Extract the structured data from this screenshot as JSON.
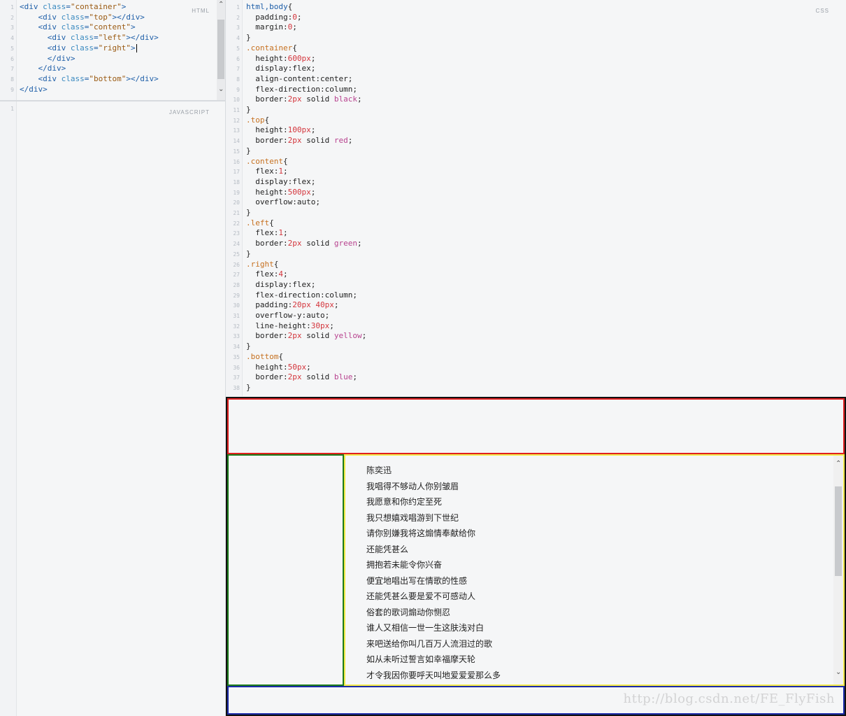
{
  "html_pane": {
    "label": "HTML",
    "lines": [
      {
        "n": "1",
        "parts": [
          [
            "tag",
            "<div "
          ],
          [
            "attr",
            "class"
          ],
          [
            "tag",
            "="
          ],
          [
            "str",
            "\"container\""
          ],
          [
            "tag",
            ">"
          ]
        ]
      },
      {
        "n": "2",
        "parts": [
          [
            "",
            "    "
          ],
          [
            "tag",
            "<div "
          ],
          [
            "attr",
            "class"
          ],
          [
            "tag",
            "="
          ],
          [
            "str",
            "\"top\""
          ],
          [
            "tag",
            "></div>"
          ]
        ]
      },
      {
        "n": "3",
        "parts": [
          [
            "",
            "    "
          ],
          [
            "tag",
            "<div "
          ],
          [
            "attr",
            "class"
          ],
          [
            "tag",
            "="
          ],
          [
            "str",
            "\"content\""
          ],
          [
            "tag",
            ">"
          ]
        ]
      },
      {
        "n": "4",
        "parts": [
          [
            "",
            "      "
          ],
          [
            "tag",
            "<div "
          ],
          [
            "attr",
            "class"
          ],
          [
            "tag",
            "="
          ],
          [
            "str",
            "\"left\""
          ],
          [
            "tag",
            "></div>"
          ]
        ]
      },
      {
        "n": "5",
        "parts": [
          [
            "",
            "      "
          ],
          [
            "tag",
            "<div "
          ],
          [
            "attr",
            "class"
          ],
          [
            "tag",
            "="
          ],
          [
            "str",
            "\"right\""
          ],
          [
            "tag",
            ">"
          ]
        ],
        "cursor": true
      },
      {
        "n": "6",
        "parts": [
          [
            "",
            "      "
          ],
          [
            "tag",
            "</div>"
          ]
        ]
      },
      {
        "n": "7",
        "parts": [
          [
            "",
            "    "
          ],
          [
            "tag",
            "</div>"
          ]
        ]
      },
      {
        "n": "8",
        "parts": [
          [
            "",
            "    "
          ],
          [
            "tag",
            "<div "
          ],
          [
            "attr",
            "class"
          ],
          [
            "tag",
            "="
          ],
          [
            "str",
            "\"bottom\""
          ],
          [
            "tag",
            "></div>"
          ]
        ]
      },
      {
        "n": "9",
        "parts": [
          [
            "tag",
            "</div>"
          ]
        ]
      }
    ]
  },
  "js_pane": {
    "label": "JAVASCRIPT",
    "lines": [
      {
        "n": "1",
        "parts": []
      }
    ]
  },
  "css_pane": {
    "label": "CSS",
    "lines": [
      {
        "n": "1",
        "parts": [
          [
            "kw",
            "html,body"
          ],
          [
            "",
            "{"
          ]
        ]
      },
      {
        "n": "2",
        "parts": [
          [
            "",
            "  padding:"
          ],
          [
            "num",
            "0"
          ],
          [
            "",
            ";"
          ]
        ]
      },
      {
        "n": "3",
        "parts": [
          [
            "",
            "  margin:"
          ],
          [
            "num",
            "0"
          ],
          [
            "",
            ";"
          ]
        ]
      },
      {
        "n": "4",
        "parts": [
          [
            "",
            "}"
          ]
        ]
      },
      {
        "n": "5",
        "parts": [
          [
            "sel",
            ".container"
          ],
          [
            "",
            "{"
          ]
        ]
      },
      {
        "n": "6",
        "parts": [
          [
            "",
            "  height:"
          ],
          [
            "num",
            "600px"
          ],
          [
            "",
            ";"
          ]
        ]
      },
      {
        "n": "7",
        "parts": [
          [
            "",
            "  display:flex;"
          ]
        ]
      },
      {
        "n": "8",
        "parts": [
          [
            "",
            "  align-content:center;"
          ]
        ]
      },
      {
        "n": "9",
        "parts": [
          [
            "",
            "  flex-direction:column;"
          ]
        ]
      },
      {
        "n": "10",
        "parts": [
          [
            "",
            "  border:"
          ],
          [
            "num",
            "2px"
          ],
          [
            "",
            " solid "
          ],
          [
            "val",
            "black"
          ],
          [
            "",
            ";"
          ]
        ]
      },
      {
        "n": "11",
        "parts": [
          [
            "",
            "}"
          ]
        ]
      },
      {
        "n": "12",
        "parts": [
          [
            "sel",
            ".top"
          ],
          [
            "",
            "{"
          ]
        ]
      },
      {
        "n": "13",
        "parts": [
          [
            "",
            "  height:"
          ],
          [
            "num",
            "100px"
          ],
          [
            "",
            ";"
          ]
        ]
      },
      {
        "n": "14",
        "parts": [
          [
            "",
            "  border:"
          ],
          [
            "num",
            "2px"
          ],
          [
            "",
            " solid "
          ],
          [
            "val",
            "red"
          ],
          [
            "",
            ";"
          ]
        ]
      },
      {
        "n": "15",
        "parts": [
          [
            "",
            "}"
          ]
        ]
      },
      {
        "n": "16",
        "parts": [
          [
            "sel",
            ".content"
          ],
          [
            "",
            "{"
          ]
        ]
      },
      {
        "n": "17",
        "parts": [
          [
            "",
            "  flex:"
          ],
          [
            "num",
            "1"
          ],
          [
            "",
            ";"
          ]
        ]
      },
      {
        "n": "18",
        "parts": [
          [
            "",
            "  display:flex;"
          ]
        ]
      },
      {
        "n": "19",
        "parts": [
          [
            "",
            "  height:"
          ],
          [
            "num",
            "500px"
          ],
          [
            "",
            ";"
          ]
        ]
      },
      {
        "n": "20",
        "parts": [
          [
            "",
            "  overflow:auto;"
          ]
        ]
      },
      {
        "n": "21",
        "parts": [
          [
            "",
            "}"
          ]
        ]
      },
      {
        "n": "22",
        "parts": [
          [
            "sel",
            ".left"
          ],
          [
            "",
            "{"
          ]
        ]
      },
      {
        "n": "23",
        "parts": [
          [
            "",
            "  flex:"
          ],
          [
            "num",
            "1"
          ],
          [
            "",
            ";"
          ]
        ]
      },
      {
        "n": "24",
        "parts": [
          [
            "",
            "  border:"
          ],
          [
            "num",
            "2px"
          ],
          [
            "",
            " solid "
          ],
          [
            "val",
            "green"
          ],
          [
            "",
            ";"
          ]
        ]
      },
      {
        "n": "25",
        "parts": [
          [
            "",
            "}"
          ]
        ]
      },
      {
        "n": "26",
        "parts": [
          [
            "sel",
            ".right"
          ],
          [
            "",
            "{"
          ]
        ]
      },
      {
        "n": "27",
        "parts": [
          [
            "",
            "  flex:"
          ],
          [
            "num",
            "4"
          ],
          [
            "",
            ";"
          ]
        ]
      },
      {
        "n": "28",
        "parts": [
          [
            "",
            "  display:flex;"
          ]
        ]
      },
      {
        "n": "29",
        "parts": [
          [
            "",
            "  flex-direction:column;"
          ]
        ]
      },
      {
        "n": "30",
        "parts": [
          [
            "",
            "  padding:"
          ],
          [
            "num",
            "20px 40px"
          ],
          [
            "",
            ";"
          ]
        ]
      },
      {
        "n": "31",
        "parts": [
          [
            "",
            "  overflow-y:auto;"
          ]
        ]
      },
      {
        "n": "32",
        "parts": [
          [
            "",
            "  line-height:"
          ],
          [
            "num",
            "30px"
          ],
          [
            "",
            ";"
          ]
        ]
      },
      {
        "n": "33",
        "parts": [
          [
            "",
            "  border:"
          ],
          [
            "num",
            "2px"
          ],
          [
            "",
            " solid "
          ],
          [
            "val",
            "yellow"
          ],
          [
            "",
            ";"
          ]
        ]
      },
      {
        "n": "34",
        "parts": [
          [
            "",
            "}"
          ]
        ]
      },
      {
        "n": "35",
        "parts": [
          [
            "sel",
            ".bottom"
          ],
          [
            "",
            "{"
          ]
        ]
      },
      {
        "n": "36",
        "parts": [
          [
            "",
            "  height:"
          ],
          [
            "num",
            "50px"
          ],
          [
            "",
            ";"
          ]
        ]
      },
      {
        "n": "37",
        "parts": [
          [
            "",
            "  border:"
          ],
          [
            "num",
            "2px"
          ],
          [
            "",
            " solid "
          ],
          [
            "val",
            "blue"
          ],
          [
            "",
            ";"
          ]
        ]
      },
      {
        "n": "38",
        "parts": [
          [
            "",
            "}"
          ]
        ]
      }
    ]
  },
  "preview": {
    "colors": {
      "container": "#111111",
      "top": "#e02020",
      "left": "#1a7a1a",
      "right": "#f2ea4a",
      "bottom": "#1a2aa8"
    },
    "lyrics": [
      "陈奕迅",
      "我唱得不够动人你别皱眉",
      "我愿意和你约定至死",
      "我只想嬉戏唱游到下世纪",
      "请你别嫌我将这煽情奉献给你",
      "还能凭甚么",
      "拥抱若未能令你兴奋",
      "便宜地唱出写在情歌的性感",
      "还能凭甚么要是爱不可感动人",
      "俗套的歌词煽动你恻忍",
      "谁人又相信一世一生这肤浅对白",
      "来吧送给你叫几百万人流泪过的歌",
      "如从未听过誓言如幸福摩天轮",
      "才令我因你要呼天叫地爱爱爱那么多"
    ],
    "watermark": "http://blog.csdn.net/FE_FlyFish",
    "scroll_up_icon": "chevron-up-icon",
    "scroll_down_icon": "chevron-down-icon"
  }
}
